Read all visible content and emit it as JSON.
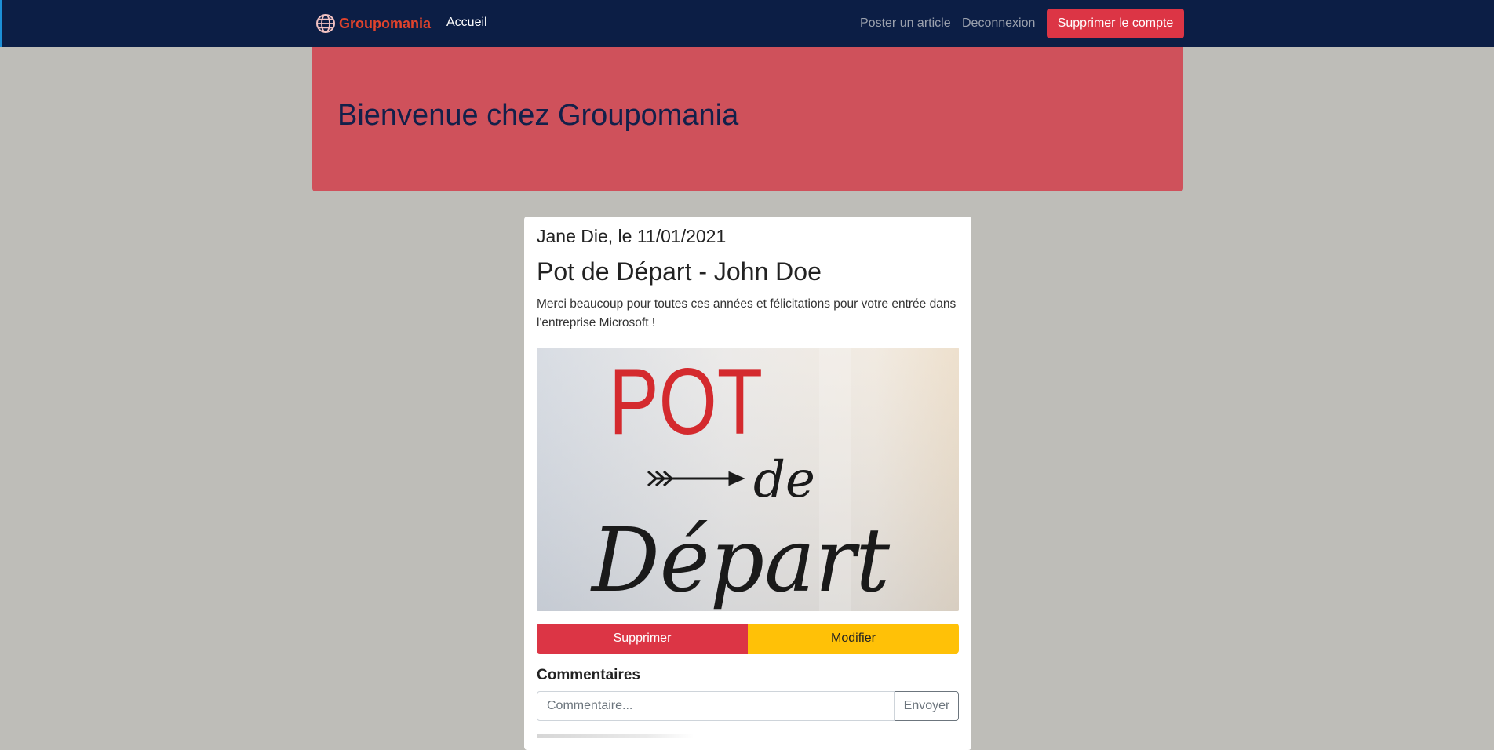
{
  "navbar": {
    "brand": "Groupomania",
    "home_link": "Accueil",
    "post_link": "Poster un article",
    "logout_link": "Deconnexion",
    "delete_account_button": "Supprimer le compte"
  },
  "hero": {
    "title": "Bienvenue chez Groupomania"
  },
  "post": {
    "author_line": "Jane Die, le 11/01/2021",
    "title": "Pot de Départ - John Doe",
    "body": "Merci beaucoup pour toutes ces années et félicitations pour votre entrée dans l'entreprise Microsoft !",
    "image_text_line1": "POT",
    "image_text_line2": "de",
    "image_text_line3": "Départ",
    "delete_button": "Supprimer",
    "edit_button": "Modifier"
  },
  "comments": {
    "title": "Commentaires",
    "input_placeholder": "Commentaire...",
    "send_button": "Envoyer"
  },
  "colors": {
    "navbar_bg": "#0c1e45",
    "brand": "#e0432c",
    "hero_bg": "#cf515b",
    "danger": "#dc3545",
    "warning": "#ffc107",
    "page_bg": "#bebdb8"
  }
}
